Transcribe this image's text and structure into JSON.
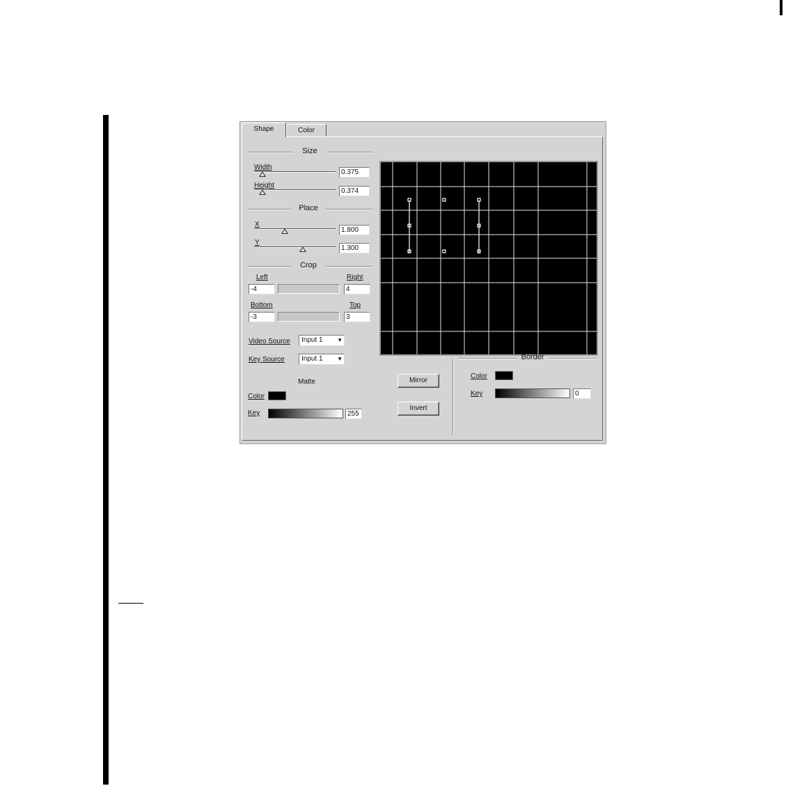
{
  "dialog": {
    "tabs": [
      {
        "label": "Shape",
        "active": true
      },
      {
        "label": "Color",
        "active": false
      }
    ],
    "size": {
      "title": "Size",
      "width": {
        "label": "Width",
        "value": "0.375",
        "position": 0.1
      },
      "height": {
        "label": "Height",
        "value": "0.374",
        "position": 0.1
      }
    },
    "place": {
      "title": "Place",
      "x": {
        "label": "X",
        "value": "1.800",
        "position": 0.38
      },
      "y": {
        "label": "Y",
        "value": "1.300",
        "position": 0.6
      }
    },
    "crop": {
      "title": "Crop",
      "left_label": "Left",
      "left_value": "-4",
      "right_label": "Right",
      "right_value": "4",
      "bottom_label": "Bottom",
      "bottom_value": "-3",
      "top_label": "Top",
      "top_value": "3"
    },
    "video_source": {
      "label": "Video Source",
      "value": "Input 1"
    },
    "key_source": {
      "label": "Key Source",
      "value": "Input 1"
    },
    "matte": {
      "title": "Matte",
      "color_label": "Color",
      "color": "#000000",
      "key_label": "Key",
      "key_value": "255"
    },
    "buttons": {
      "mirror": "Mirror",
      "invert": "Invert"
    },
    "border": {
      "title": "Border",
      "color_label": "Color",
      "color": "#000000",
      "key_label": "Key",
      "key_value": "0"
    }
  }
}
